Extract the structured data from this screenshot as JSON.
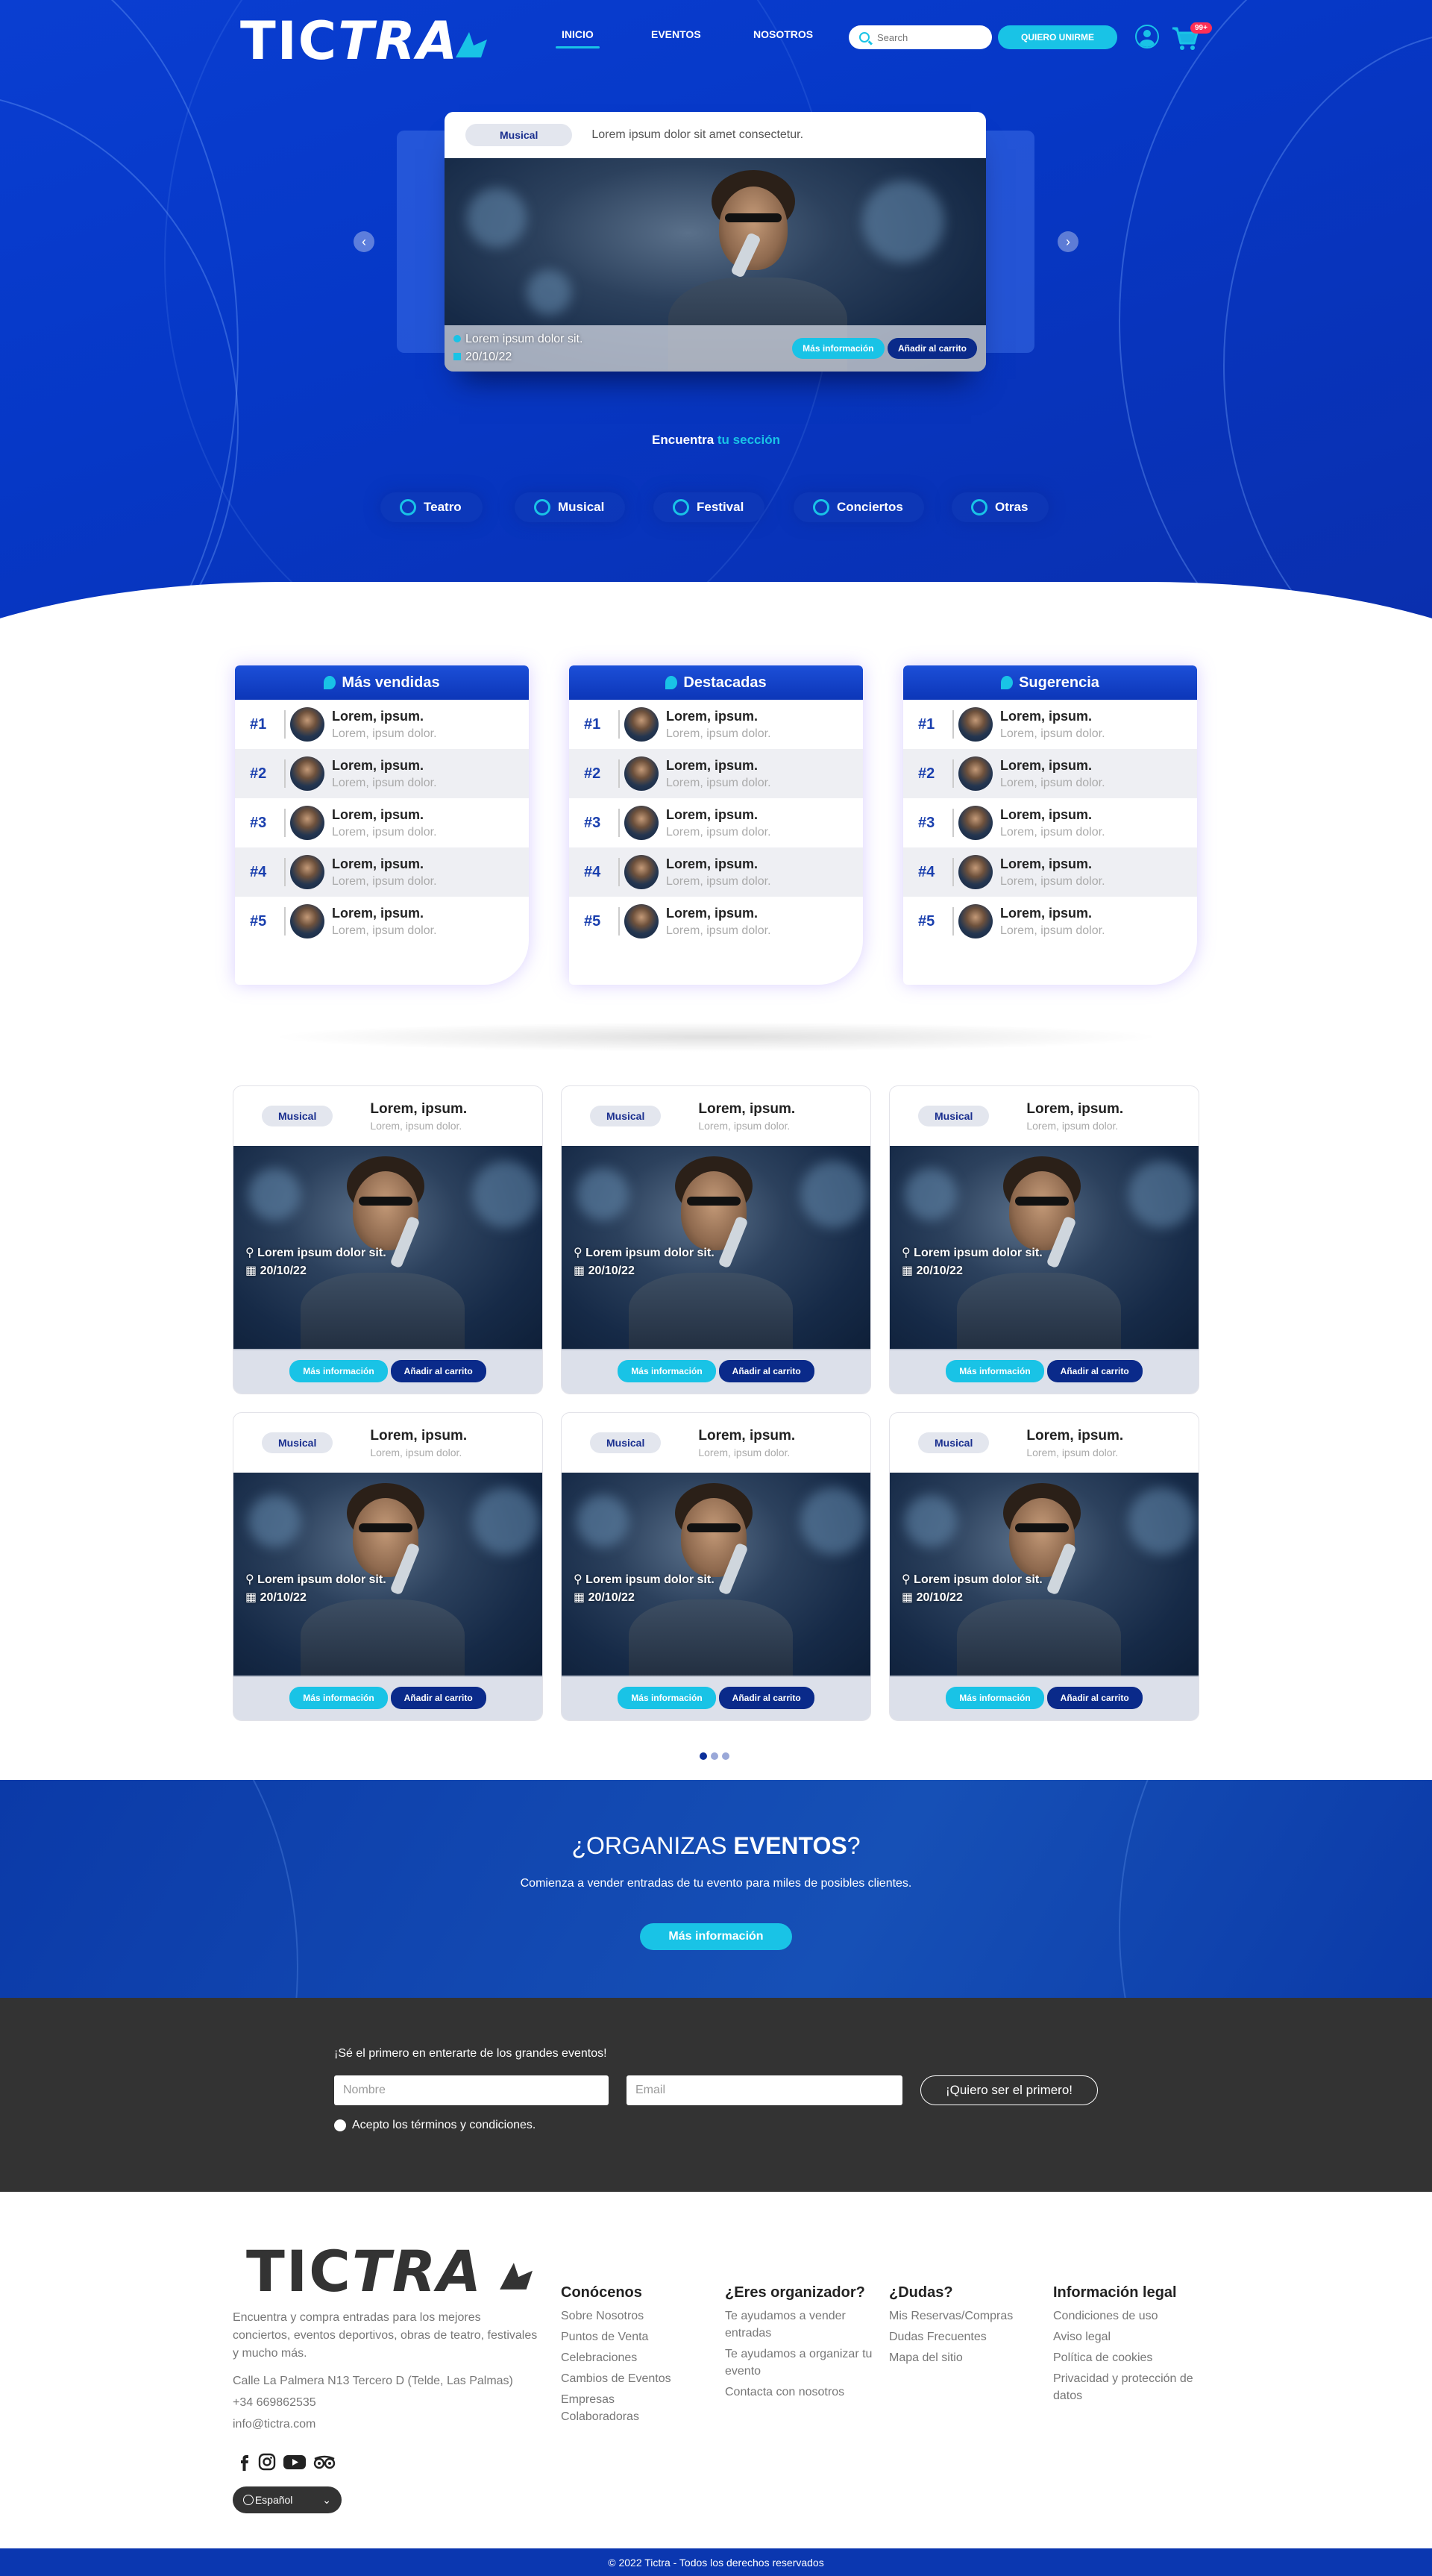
{
  "brand": {
    "logo_left": "TIC",
    "logo_right": "TRA"
  },
  "nav": {
    "items": [
      {
        "label": "INICIO"
      },
      {
        "label": "EVENTOS"
      },
      {
        "label": "NOSOTROS"
      }
    ]
  },
  "search": {
    "placeholder": "Search"
  },
  "header": {
    "join_label": "QUIERO UNIRME",
    "cart_badge": "99+"
  },
  "hero": {
    "slide": {
      "category": "Musical",
      "title": "Lorem ipsum dolor sit amet consectetur.",
      "location": "Lorem ipsum dolor sit.",
      "date": "20/10/22",
      "more_label": "Más información",
      "cart_label": "Añadir al carrito"
    },
    "find_prefix": "Encuentra",
    "find_highlight": "tu sección",
    "categories": [
      {
        "label": "Teatro"
      },
      {
        "label": "Musical"
      },
      {
        "label": "Festival"
      },
      {
        "label": "Conciertos"
      },
      {
        "label": "Otras"
      }
    ]
  },
  "rankings": [
    {
      "title": "Más vendidas",
      "rows": [
        {
          "num": "#1",
          "t1": "Lorem, ipsum.",
          "t2": "Lorem, ipsum dolor."
        },
        {
          "num": "#2",
          "t1": "Lorem, ipsum.",
          "t2": "Lorem, ipsum dolor."
        },
        {
          "num": "#3",
          "t1": "Lorem, ipsum.",
          "t2": "Lorem, ipsum dolor."
        },
        {
          "num": "#4",
          "t1": "Lorem, ipsum.",
          "t2": "Lorem, ipsum dolor."
        },
        {
          "num": "#5",
          "t1": "Lorem, ipsum.",
          "t2": "Lorem, ipsum dolor."
        }
      ]
    },
    {
      "title": "Destacadas",
      "rows": [
        {
          "num": "#1",
          "t1": "Lorem, ipsum.",
          "t2": "Lorem, ipsum dolor."
        },
        {
          "num": "#2",
          "t1": "Lorem, ipsum.",
          "t2": "Lorem, ipsum dolor."
        },
        {
          "num": "#3",
          "t1": "Lorem, ipsum.",
          "t2": "Lorem, ipsum dolor."
        },
        {
          "num": "#4",
          "t1": "Lorem, ipsum.",
          "t2": "Lorem, ipsum dolor."
        },
        {
          "num": "#5",
          "t1": "Lorem, ipsum.",
          "t2": "Lorem, ipsum dolor."
        }
      ]
    },
    {
      "title": "Sugerencia",
      "rows": [
        {
          "num": "#1",
          "t1": "Lorem, ipsum.",
          "t2": "Lorem, ipsum dolor."
        },
        {
          "num": "#2",
          "t1": "Lorem, ipsum.",
          "t2": "Lorem, ipsum dolor."
        },
        {
          "num": "#3",
          "t1": "Lorem, ipsum.",
          "t2": "Lorem, ipsum dolor."
        },
        {
          "num": "#4",
          "t1": "Lorem, ipsum.",
          "t2": "Lorem, ipsum dolor."
        },
        {
          "num": "#5",
          "t1": "Lorem, ipsum.",
          "t2": "Lorem, ipsum dolor."
        }
      ]
    }
  ],
  "events": [
    {
      "category": "Musical",
      "title": "Lorem, ipsum.",
      "subtitle": "Lorem, ipsum dolor.",
      "location": "Lorem ipsum dolor sit.",
      "date": "20/10/22",
      "more_label": "Más información",
      "cart_label": "Añadir al carrito"
    },
    {
      "category": "Musical",
      "title": "Lorem, ipsum.",
      "subtitle": "Lorem, ipsum dolor.",
      "location": "Lorem ipsum dolor sit.",
      "date": "20/10/22",
      "more_label": "Más información",
      "cart_label": "Añadir al carrito"
    },
    {
      "category": "Musical",
      "title": "Lorem, ipsum.",
      "subtitle": "Lorem, ipsum dolor.",
      "location": "Lorem ipsum dolor sit.",
      "date": "20/10/22",
      "more_label": "Más información",
      "cart_label": "Añadir al carrito"
    },
    {
      "category": "Musical",
      "title": "Lorem, ipsum.",
      "subtitle": "Lorem, ipsum dolor.",
      "location": "Lorem ipsum dolor sit.",
      "date": "20/10/22",
      "more_label": "Más información",
      "cart_label": "Añadir al carrito"
    },
    {
      "category": "Musical",
      "title": "Lorem, ipsum.",
      "subtitle": "Lorem, ipsum dolor.",
      "location": "Lorem ipsum dolor sit.",
      "date": "20/10/22",
      "more_label": "Más información",
      "cart_label": "Añadir al carrito"
    },
    {
      "category": "Musical",
      "title": "Lorem, ipsum.",
      "subtitle": "Lorem, ipsum dolor.",
      "location": "Lorem ipsum dolor sit.",
      "date": "20/10/22",
      "more_label": "Más información",
      "cart_label": "Añadir al carrito"
    }
  ],
  "organize": {
    "title_prefix": "¿ORGANIZAS ",
    "title_bold": "EVENTOS",
    "title_suffix": "?",
    "subtitle": "Comienza a vender entradas de tu evento para miles de posibles clientes.",
    "button": "Más información"
  },
  "newsletter": {
    "lead": "¡Sé el primero en enterarte de los grandes eventos!",
    "name_placeholder": "Nombre",
    "email_placeholder": "Email",
    "button": "¡Quiero ser el primero!",
    "terms": "Acepto los términos y condiciones."
  },
  "footer": {
    "description": "Encuentra y compra entradas para los mejores conciertos, eventos deportivos, obras de teatro, festivales y mucho más.",
    "address": "Calle La Palmera N13 Tercero D (Telde, Las Palmas)",
    "phone": "+34 669862535",
    "email": "info@tictra.com",
    "language": "Español",
    "columns": [
      {
        "title": "Conócenos",
        "links": [
          "Sobre Nosotros",
          "Puntos de Venta",
          "Celebraciones",
          "Cambios de Eventos",
          "Empresas Colaboradoras"
        ]
      },
      {
        "title": "¿Eres organizador?",
        "links": [
          "Te ayudamos a vender entradas",
          "Te ayudamos a organizar tu evento",
          "Contacta con nosotros"
        ]
      },
      {
        "title": "¿Dudas?",
        "links": [
          "Mis Reservas/Compras",
          "Dudas Frecuentes",
          "Mapa del sitio"
        ]
      },
      {
        "title": "Información legal",
        "links": [
          "Condiciones de uso",
          "Aviso legal",
          "Política de cookies",
          "Privacidad y protección de datos"
        ]
      }
    ],
    "copyright": "© 2022 Tictra - Todos los derechos reservados"
  },
  "colors": {
    "primary": "#0638c7",
    "accent": "#19c3e6",
    "dark": "#333333",
    "badge": "#ff2f55"
  }
}
